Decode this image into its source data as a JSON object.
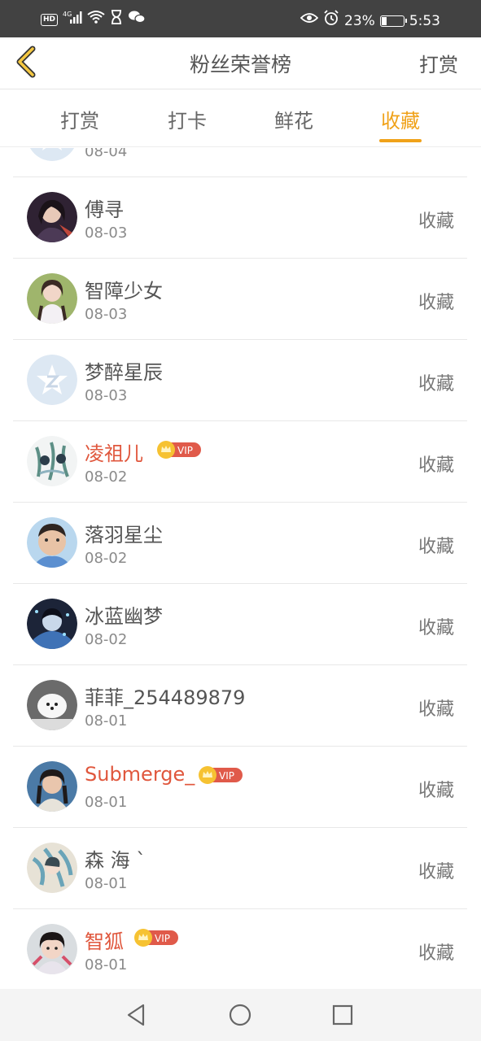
{
  "status_bar": {
    "left_icons": [
      "hd-icon",
      "4g-signal-icon",
      "wifi-icon",
      "hourglass-icon",
      "wechat-icon"
    ],
    "network": "4G",
    "right_icons": [
      "eye-icon",
      "alarm-icon"
    ],
    "battery": "23%",
    "battery_level": 0.23,
    "time": "5:53"
  },
  "header": {
    "title": "粉丝荣誉榜",
    "action": "打赏"
  },
  "tabs": [
    {
      "label": "打赏",
      "active": false
    },
    {
      "label": "打卡",
      "active": false
    },
    {
      "label": "鲜花",
      "active": false
    },
    {
      "label": "收藏",
      "active": true
    }
  ],
  "colors": {
    "accent": "#f0a21a",
    "vip_name": "#e0573d",
    "vip_badge": "#e05a4a"
  },
  "list": [
    {
      "name": "",
      "date": "08-04",
      "action": "收藏",
      "vip": false,
      "avatar": "default-star-avatar"
    },
    {
      "name": "傅寻",
      "date": "08-03",
      "action": "收藏",
      "vip": false,
      "avatar": "user-avatar"
    },
    {
      "name": "智障少女",
      "date": "08-03",
      "action": "收藏",
      "vip": false,
      "avatar": "user-avatar"
    },
    {
      "name": "梦醉星辰",
      "date": "08-03",
      "action": "收藏",
      "vip": false,
      "avatar": "default-star-avatar"
    },
    {
      "name": "凌祖儿",
      "date": "08-02",
      "action": "收藏",
      "vip": true,
      "vip_label": "VIP",
      "avatar": "user-avatar"
    },
    {
      "name": "落羽星尘",
      "date": "08-02",
      "action": "收藏",
      "vip": false,
      "avatar": "user-avatar"
    },
    {
      "name": "冰蓝幽梦",
      "date": "08-02",
      "action": "收藏",
      "vip": false,
      "avatar": "user-avatar"
    },
    {
      "name": "菲菲_254489879",
      "date": "08-01",
      "action": "收藏",
      "vip": false,
      "avatar": "user-avatar"
    },
    {
      "name": "Submerge_",
      "date": "08-01",
      "action": "收藏",
      "vip": true,
      "vip_label": "VIP",
      "avatar": "user-avatar"
    },
    {
      "name": "森 海 ˋ",
      "date": "08-01",
      "action": "收藏",
      "vip": false,
      "avatar": "user-avatar"
    },
    {
      "name": "智狐",
      "date": "08-01",
      "action": "收藏",
      "vip": true,
      "vip_label": "VIP",
      "avatar": "user-avatar"
    }
  ],
  "nav_bar": {
    "buttons": [
      "back-triangle-icon",
      "home-circle-icon",
      "recents-square-icon"
    ]
  }
}
